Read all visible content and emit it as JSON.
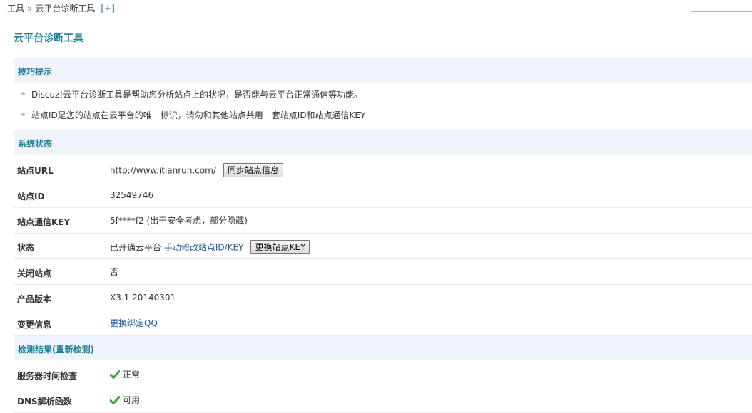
{
  "breadcrumb": {
    "root": "工具",
    "separator": "»",
    "current": "云平台诊断工具",
    "add": "[+]"
  },
  "page_title": "云平台诊断工具",
  "tips": {
    "heading": "技巧提示",
    "items": [
      "Discuz!云平台诊断工具是帮助您分析站点上的状况，是否能与云平台正常通信等功能。",
      "站点ID是您的站点在云平台的唯一标识，请勿和其他站点共用一套站点ID和站点通信KEY"
    ]
  },
  "system_status": {
    "heading": "系统状态",
    "site_url": {
      "label": "站点URL",
      "value": "http://www.itianrun.com/",
      "button": "同步站点信息"
    },
    "site_id": {
      "label": "站点ID",
      "value": "32549746"
    },
    "site_key": {
      "label": "站点通信KEY",
      "value": "5f****f2 (出于安全考虑，部分隐藏)"
    },
    "status": {
      "label": "状态",
      "value": "已开通云平台",
      "link": "手动修改站点ID/KEY",
      "button": "更换站点KEY"
    },
    "site_closed": {
      "label": "关闭站点",
      "value": "否"
    },
    "product_version": {
      "label": "产品版本",
      "value": "X3.1 20140301"
    },
    "change_info": {
      "label": "变更信息",
      "link": "更换绑定QQ"
    }
  },
  "check_results": {
    "heading": "检测结果(重新检测)",
    "items": [
      {
        "label": "服务器时间检查",
        "value": "正常"
      },
      {
        "label": "DNS解析函数",
        "value": "可用"
      }
    ]
  },
  "colors": {
    "accent": "#1a7c97",
    "section_bg": "#eef4f9",
    "link": "#1d5c9c",
    "ok": "#3aa63a"
  }
}
